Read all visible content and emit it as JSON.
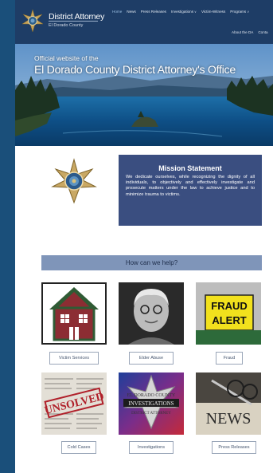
{
  "header": {
    "title": "District Attorney",
    "subtitle": "El Dorado County",
    "nav": [
      {
        "label": "Home",
        "active": true,
        "dropdown": false
      },
      {
        "label": "News",
        "active": false,
        "dropdown": false
      },
      {
        "label": "Press Releases",
        "active": false,
        "dropdown": false
      },
      {
        "label": "Investigations",
        "active": false,
        "dropdown": true
      },
      {
        "label": "Victim-Witness",
        "active": false,
        "dropdown": false
      },
      {
        "label": "Programs",
        "active": false,
        "dropdown": true
      }
    ],
    "nav_second_row": [
      "About the DA",
      "Conta"
    ]
  },
  "hero": {
    "pretitle": "Official website of the",
    "title": "El Dorado County District Attorney's Office"
  },
  "mission": {
    "heading": "Mission Statement",
    "body": "We dedicate ourselves, while recognizing the dignity of all individuals, to objectively and effectively investigate and prosecute matters under the law to achieve justice and to minimize trauma to victims."
  },
  "help": {
    "heading": "How can we help?",
    "cards": [
      {
        "label": "Victim Services",
        "icon": "house-icon"
      },
      {
        "label": "Elder Abuse",
        "icon": "elder-photo"
      },
      {
        "label": "Fraud",
        "icon": "fraud-alert-sign"
      },
      {
        "label": "Cold Cases",
        "icon": "newspaper-unsolved"
      },
      {
        "label": "Investigations",
        "icon": "investigations-badge"
      },
      {
        "label": "Press Releases",
        "icon": "news-typewriter"
      }
    ],
    "fraud_sign_lines": [
      "FRAUD",
      "ALERT"
    ],
    "cold_case_stamp": "UNSOLVED",
    "investigations_badge_lines": [
      "EL DORADO COUNTY",
      "INVESTIGATIONS",
      "DISTRICT ATTORNEY"
    ],
    "news_text": "NEWS"
  },
  "colors": {
    "header_bg": "#1e3d66",
    "mission_bg": "#3a4e80",
    "help_bar_bg": "#7f95b9",
    "page_backdrop": "#1a4f7a"
  }
}
